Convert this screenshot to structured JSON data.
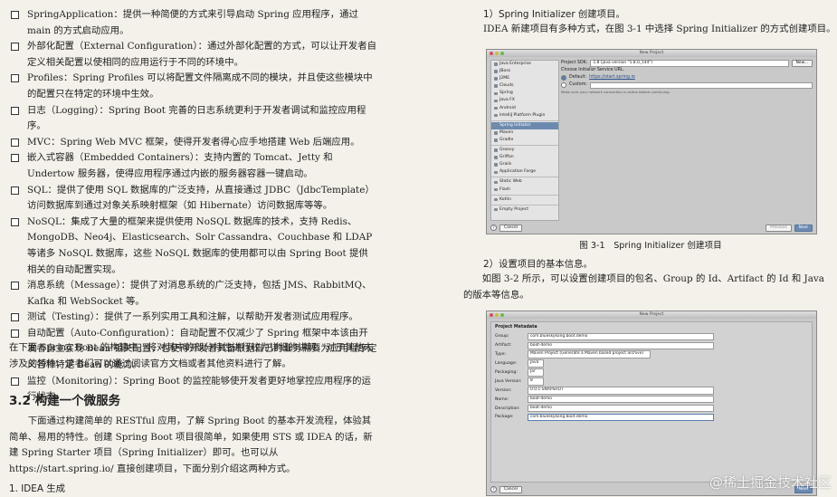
{
  "left": {
    "bullets": [
      "SpringApplication：提供一种简便的方式来引导启动 Spring 应用程序，通过 main 的方式启动应用。",
      "外部化配置（External Configuration）：通过外部化配置的方式，可以让开发者自定义相关配置以使相同的应用运行于不同的环境中。",
      "Profiles：Spring Profiles 可以将配置文件隔离成不同的模块，并且使这些模块中的配置只在特定的环境中生效。",
      "日志（Logging）：Spring Boot 完善的日志系统更利于开发者调试和监控应用程序。",
      "MVC：Spring Web MVC 框架，使得开发者得心应手地搭建 Web 后端应用。",
      "嵌入式容器（Embedded Containers）：支持内置的 Tomcat、Jetty 和 Undertow 服务器，使得应用程序通过内嵌的服务器容器一键启动。",
      "SQL：提供了使用 SQL 数据库的广泛支持，从直接通过 JDBC（JdbcTemplate）访问数据库到通过对象关系映射框架（如 Hibernate）访问数据库等等。",
      "NoSQL：集成了大量的框架来提供使用 NoSQL 数据库的技术，支持 Redis、MongoDB、Neo4j、Elasticsearch、Solr Cassandra、Couchbase 和 LDAP 等诸多 NoSQL 数据库，这些 NoSQL 数据库的使用都可以由 Spring Boot 提供相关的自动配置实现。",
      "消息系统（Message）：提供了对消息系统的广泛支持，包括 JMS、RabbitMQ、Kafka 和 WebSocket 等。",
      "测试（Testing）：提供了一系列实用工具和注解，以帮助开发者测试应用程序。",
      "自动配置（Auto-Configuration）：自动配置不仅减少了 Spring 框架中本该由开发者自主实现 Bean 相关配置，也使得开发者具备根据自己的业务需要为应用程序定义各种特定 Bean 的能力。",
      "监控（Monitoring）：Spring Boot 的监控能够使开发者更好地掌控应用程序的运行状态。"
    ],
    "summary": "在下面 Spring Boot 的构建中，将对其中的部分特性进行较为详细的讲解，对于其他未涉及的特性，读者们可以通过阅读官方文档或者其他资料进行了解。",
    "section_title": "3.2 构建一个微服务",
    "section_para": "下面通过构建简单的 RESTful 应用，了解 Spring Boot 的基本开发流程，体验其简单、易用的特性。创建 Spring Boot 项目很简单，如果使用 STS 或 IDEA 的话，新建 Spring Starter 项目（Spring Initializer）即可。也可以从 https://start.spring.io/ 直接创建项目，下面分别介绍这两种方式。",
    "sub_heading": "1. IDEA 生成"
  },
  "right": {
    "step1_title": "1）Spring Initializer 创建项目。",
    "step1_text": "IDEA 新建项目有多种方式，在图 3-1 中选择 Spring Initializer 的方式创建项目。",
    "fig1": {
      "window_title": "New Project",
      "sidebar": [
        "Java Enterprise",
        "JBoss",
        "J2ME",
        "Clouds",
        "Spring",
        "Java FX",
        "Android",
        "IntelliJ Platform Plugin",
        "Spring Initializr",
        "Maven",
        "Gradle",
        "Groovy",
        "Griffon",
        "Grails",
        "Application Forge",
        "Static Web",
        "Flash",
        "Kotlin",
        "Empty Project"
      ],
      "selected": "Spring Initializr",
      "sdk_label": "Project SDK:",
      "sdk_value": "1.8 (java version \"1.8.0_144\")",
      "new_btn": "New...",
      "choose_label": "Choose Initializr Service URL.",
      "default_label": "Default:",
      "default_url": "https://start.spring.io",
      "custom_label": "Custom:",
      "note": "Make sure your network connection is active before continuing.",
      "help": "?",
      "cancel": "Cancel",
      "previous": "Previous",
      "next": "Next"
    },
    "fig1_caption": "图 3-1　Spring Initializer 创建项目",
    "step2_title": "2）设置项目的基本信息。",
    "step2_text": "如图 3-2 所示，可以设置创建项目的包名、Group 的 Id、Artifact 的 Id 和 Java 的版本等信息。",
    "fig2": {
      "window_title": "New Project",
      "header": "Project Metadata",
      "fields": [
        {
          "label": "Group:",
          "value": "com.blueskykong.boot.demo"
        },
        {
          "label": "Artifact:",
          "value": "boot-demo"
        },
        {
          "label": "Type:",
          "value": "Maven Project (Generate a Maven based project archive)"
        },
        {
          "label": "Language:",
          "value": "Java"
        },
        {
          "label": "Packaging:",
          "value": "Jar"
        },
        {
          "label": "Java Version:",
          "value": "8"
        },
        {
          "label": "Version:",
          "value": "0.0.1-SNAPSHOT"
        },
        {
          "label": "Name:",
          "value": "boot-demo"
        },
        {
          "label": "Description:",
          "value": "boot-demo"
        },
        {
          "label": "Package:",
          "value": "com.blueskykong.boot.demo"
        }
      ],
      "help": "?",
      "cancel": "Cancel",
      "next": "Next"
    },
    "watermark": "@稀土掘金技术社区"
  }
}
